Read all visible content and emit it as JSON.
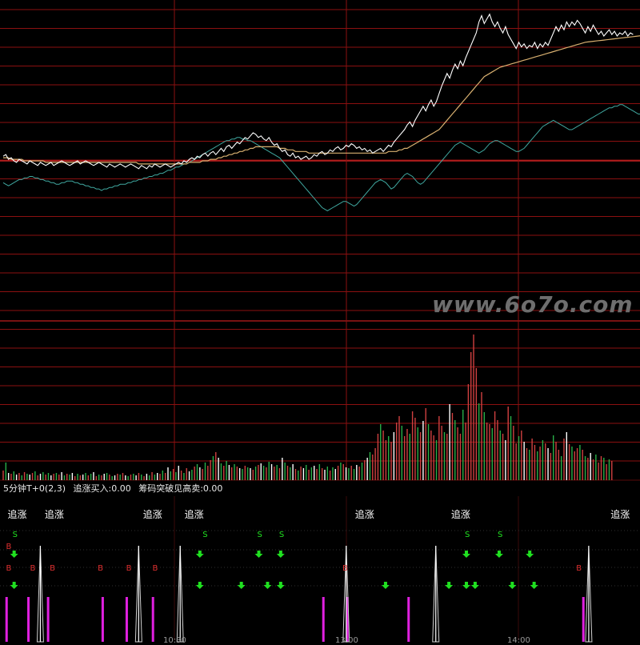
{
  "watermark": "www.6o7o.com",
  "indicator": {
    "name": "5分钟T+0(2,3)",
    "buy_label": "追涨买入:0.00",
    "sell_label": "筹码突破见高卖:0.00"
  },
  "chase_label": "追涨",
  "buy_marker": "B",
  "sell_marker": "S",
  "colors": {
    "background": "#000000",
    "grid": "#8b1010",
    "price": "#ffffff",
    "avg_price": "#d8b070",
    "ma_line": "#40a8a0",
    "vol_up": "#d04040",
    "vol_down": "#28b048",
    "vol_flat": "#ffffff",
    "bar_magenta": "#e020e0",
    "arrow": "#20e020",
    "b_marker": "#e03030",
    "s_marker": "#20e020"
  },
  "chart_data": {
    "type": "line",
    "panels": [
      "price",
      "volume",
      "indicator"
    ],
    "x_count": 240,
    "price": [
      0.3,
      0.4,
      0.1,
      0.2,
      0.0,
      -0.1,
      0.1,
      0.0,
      -0.1,
      -0.2,
      0.0,
      -0.1,
      -0.2,
      -0.3,
      -0.1,
      -0.2,
      -0.3,
      -0.2,
      -0.1,
      -0.3,
      -0.2,
      -0.1,
      0.0,
      -0.1,
      -0.2,
      -0.3,
      -0.2,
      -0.1,
      0.0,
      -0.2,
      -0.1,
      0.0,
      -0.1,
      -0.2,
      -0.3,
      -0.2,
      -0.1,
      -0.2,
      -0.3,
      -0.4,
      -0.2,
      -0.3,
      -0.4,
      -0.3,
      -0.2,
      -0.3,
      -0.4,
      -0.3,
      -0.2,
      -0.3,
      -0.4,
      -0.5,
      -0.3,
      -0.4,
      -0.5,
      -0.3,
      -0.4,
      -0.2,
      -0.3,
      -0.4,
      -0.3,
      -0.2,
      -0.3,
      -0.4,
      -0.3,
      -0.2,
      -0.1,
      -0.2,
      0.0,
      -0.1,
      0.1,
      0.2,
      0.1,
      0.3,
      0.2,
      0.4,
      0.5,
      0.3,
      0.5,
      0.6,
      0.4,
      0.6,
      0.8,
      0.6,
      0.9,
      1.0,
      0.8,
      1.0,
      1.2,
      1.1,
      1.3,
      1.5,
      1.4,
      1.6,
      1.8,
      1.7,
      1.5,
      1.6,
      1.4,
      1.3,
      1.5,
      1.2,
      1.0,
      1.1,
      0.8,
      0.6,
      0.7,
      0.4,
      0.3,
      0.5,
      0.2,
      0.3,
      0.1,
      0.2,
      0.3,
      0.1,
      0.2,
      0.4,
      0.3,
      0.5,
      0.6,
      0.4,
      0.5,
      0.7,
      0.6,
      0.8,
      0.9,
      0.7,
      0.8,
      1.0,
      0.9,
      1.1,
      1.0,
      0.8,
      0.9,
      0.7,
      0.8,
      0.6,
      0.7,
      0.5,
      0.6,
      0.7,
      0.8,
      0.6,
      0.8,
      1.0,
      0.9,
      1.2,
      1.4,
      1.6,
      1.8,
      2.0,
      2.3,
      2.5,
      2.2,
      2.6,
      2.9,
      3.2,
      3.5,
      3.2,
      3.6,
      3.9,
      3.5,
      3.8,
      4.3,
      4.8,
      5.2,
      5.6,
      5.3,
      5.8,
      6.2,
      5.9,
      6.4,
      6.1,
      6.6,
      7.0,
      7.4,
      7.8,
      8.2,
      8.9,
      9.3,
      8.8,
      9.1,
      9.4,
      8.9,
      8.6,
      8.9,
      8.5,
      8.2,
      8.6,
      8.1,
      7.8,
      7.5,
      7.2,
      7.6,
      7.3,
      7.5,
      7.2,
      7.4,
      7.3,
      7.6,
      7.2,
      7.5,
      7.3,
      7.6,
      7.4,
      7.8,
      8.2,
      8.6,
      8.3,
      8.7,
      8.4,
      8.9,
      8.6,
      8.9,
      8.7,
      9.0,
      8.8,
      8.5,
      8.2,
      8.6,
      8.3,
      8.7,
      8.4,
      8.1,
      8.3,
      8.0,
      8.2,
      8.4,
      8.1,
      8.3,
      8.0,
      8.2,
      8.1,
      8.3,
      8.0,
      8.2,
      8.1
    ],
    "avg_price": [
      0.2,
      0.2,
      0.2,
      0.1,
      0.1,
      0.1,
      0.1,
      0.1,
      0.0,
      0.0,
      0.0,
      0.0,
      0.0,
      0.0,
      0.0,
      0.0,
      -0.1,
      -0.1,
      -0.1,
      -0.1,
      -0.1,
      -0.1,
      -0.1,
      -0.1,
      -0.1,
      -0.1,
      -0.1,
      -0.1,
      -0.1,
      -0.1,
      -0.1,
      -0.1,
      -0.1,
      -0.1,
      -0.1,
      -0.1,
      -0.1,
      -0.1,
      -0.1,
      -0.1,
      -0.1,
      -0.1,
      -0.1,
      -0.1,
      -0.1,
      -0.1,
      -0.1,
      -0.1,
      -0.1,
      -0.1,
      -0.1,
      -0.2,
      -0.2,
      -0.2,
      -0.2,
      -0.2,
      -0.2,
      -0.2,
      -0.2,
      -0.2,
      -0.2,
      -0.2,
      -0.2,
      -0.2,
      -0.2,
      -0.2,
      -0.2,
      -0.2,
      -0.2,
      -0.2,
      -0.1,
      -0.1,
      -0.1,
      -0.1,
      -0.1,
      0.0,
      0.0,
      0.0,
      0.1,
      0.1,
      0.1,
      0.2,
      0.2,
      0.3,
      0.3,
      0.4,
      0.4,
      0.5,
      0.5,
      0.6,
      0.6,
      0.7,
      0.7,
      0.8,
      0.8,
      0.9,
      0.9,
      0.9,
      0.9,
      0.9,
      0.9,
      0.9,
      0.9,
      0.9,
      0.8,
      0.8,
      0.8,
      0.7,
      0.7,
      0.7,
      0.6,
      0.6,
      0.6,
      0.6,
      0.6,
      0.5,
      0.5,
      0.5,
      0.5,
      0.5,
      0.5,
      0.5,
      0.5,
      0.5,
      0.5,
      0.5,
      0.5,
      0.5,
      0.5,
      0.5,
      0.5,
      0.5,
      0.5,
      0.5,
      0.5,
      0.5,
      0.5,
      0.5,
      0.5,
      0.5,
      0.5,
      0.5,
      0.5,
      0.5,
      0.5,
      0.6,
      0.6,
      0.6,
      0.6,
      0.7,
      0.7,
      0.8,
      0.8,
      0.9,
      1.0,
      1.1,
      1.2,
      1.3,
      1.4,
      1.5,
      1.6,
      1.7,
      1.8,
      1.9,
      2.0,
      2.2,
      2.4,
      2.6,
      2.8,
      3.0,
      3.2,
      3.4,
      3.6,
      3.8,
      4.0,
      4.2,
      4.4,
      4.6,
      4.8,
      5.0,
      5.2,
      5.4,
      5.5,
      5.6,
      5.7,
      5.8,
      5.9,
      6.0,
      6.05,
      6.1,
      6.15,
      6.2,
      6.25,
      6.3,
      6.35,
      6.4,
      6.45,
      6.5,
      6.55,
      6.6,
      6.65,
      6.7,
      6.75,
      6.8,
      6.85,
      6.9,
      6.95,
      7.0,
      7.05,
      7.1,
      7.15,
      7.2,
      7.25,
      7.3,
      7.35,
      7.4,
      7.45,
      7.5,
      7.55,
      7.6,
      7.62,
      7.64,
      7.66,
      7.68,
      7.7,
      7.72,
      7.74,
      7.76,
      7.78,
      7.8,
      7.82,
      7.84,
      7.86,
      7.88,
      7.9,
      7.92,
      7.94,
      7.96,
      7.98,
      8.0,
      8.02,
      8.04,
      8.05,
      8.06,
      8.07,
      8.08,
      8.09,
      8.1,
      8.1,
      8.1,
      8.1,
      8.1
    ],
    "ma_line": [
      -1.4,
      -1.5,
      -1.6,
      -1.5,
      -1.4,
      -1.3,
      -1.2,
      -1.2,
      -1.1,
      -1.1,
      -1.0,
      -1.0,
      -1.1,
      -1.1,
      -1.2,
      -1.2,
      -1.3,
      -1.3,
      -1.4,
      -1.4,
      -1.5,
      -1.5,
      -1.4,
      -1.4,
      -1.3,
      -1.3,
      -1.3,
      -1.4,
      -1.4,
      -1.5,
      -1.5,
      -1.6,
      -1.6,
      -1.7,
      -1.7,
      -1.8,
      -1.8,
      -1.9,
      -1.8,
      -1.8,
      -1.7,
      -1.7,
      -1.6,
      -1.6,
      -1.5,
      -1.5,
      -1.5,
      -1.4,
      -1.4,
      -1.3,
      -1.3,
      -1.2,
      -1.2,
      -1.1,
      -1.1,
      -1.0,
      -1.0,
      -0.9,
      -0.9,
      -0.8,
      -0.8,
      -0.7,
      -0.6,
      -0.6,
      -0.5,
      -0.4,
      -0.4,
      -0.3,
      -0.2,
      -0.2,
      -0.1,
      0.0,
      0.1,
      0.2,
      0.3,
      0.4,
      0.5,
      0.6,
      0.7,
      0.8,
      0.9,
      1.0,
      1.1,
      1.2,
      1.3,
      1.3,
      1.4,
      1.4,
      1.5,
      1.5,
      1.4,
      1.4,
      1.3,
      1.3,
      1.2,
      1.1,
      1.0,
      0.9,
      0.8,
      0.7,
      0.6,
      0.5,
      0.4,
      0.3,
      0.2,
      0.0,
      -0.2,
      -0.4,
      -0.6,
      -0.8,
      -1.0,
      -1.2,
      -1.4,
      -1.6,
      -1.8,
      -2.0,
      -2.2,
      -2.4,
      -2.6,
      -2.8,
      -3.0,
      -3.1,
      -3.2,
      -3.1,
      -3.0,
      -2.9,
      -2.8,
      -2.7,
      -2.6,
      -2.6,
      -2.7,
      -2.8,
      -2.9,
      -2.8,
      -2.6,
      -2.4,
      -2.2,
      -2.0,
      -1.8,
      -1.6,
      -1.4,
      -1.3,
      -1.2,
      -1.3,
      -1.4,
      -1.6,
      -1.8,
      -1.7,
      -1.5,
      -1.3,
      -1.1,
      -0.9,
      -0.8,
      -0.9,
      -1.0,
      -1.2,
      -1.4,
      -1.5,
      -1.4,
      -1.2,
      -1.0,
      -0.8,
      -0.6,
      -0.4,
      -0.2,
      0.0,
      0.2,
      0.4,
      0.6,
      0.8,
      1.0,
      1.1,
      1.2,
      1.1,
      1.0,
      0.9,
      0.8,
      0.7,
      0.6,
      0.5,
      0.6,
      0.7,
      0.9,
      1.1,
      1.2,
      1.3,
      1.3,
      1.2,
      1.1,
      1.0,
      0.9,
      0.8,
      0.7,
      0.6,
      0.6,
      0.7,
      0.8,
      1.0,
      1.2,
      1.4,
      1.6,
      1.8,
      2.0,
      2.2,
      2.3,
      2.4,
      2.5,
      2.6,
      2.5,
      2.4,
      2.3,
      2.2,
      2.1,
      2.0,
      2.0,
      2.1,
      2.2,
      2.3,
      2.4,
      2.5,
      2.6,
      2.7,
      2.8,
      2.9,
      3.0,
      3.1,
      3.2,
      3.3,
      3.4,
      3.4,
      3.5,
      3.5,
      3.6,
      3.6,
      3.5,
      3.4,
      3.3,
      3.2,
      3.1,
      3.0,
      3.0,
      3.1,
      3.2,
      3.3,
      3.4
    ],
    "volume": [
      12,
      22,
      9,
      8,
      11,
      7,
      9,
      6,
      10,
      8,
      7,
      9,
      11,
      6,
      8,
      10,
      7,
      9,
      6,
      8,
      9,
      7,
      10,
      6,
      8,
      7,
      9,
      5,
      8,
      6,
      7,
      9,
      6,
      8,
      10,
      5,
      7,
      6,
      8,
      9,
      7,
      5,
      6,
      8,
      7,
      9,
      6,
      5,
      7,
      8,
      6,
      9,
      7,
      5,
      8,
      6,
      10,
      7,
      9,
      8,
      12,
      9,
      16,
      11,
      14,
      10,
      18,
      12,
      9,
      15,
      11,
      13,
      17,
      20,
      16,
      14,
      22,
      18,
      25,
      30,
      35,
      28,
      21,
      18,
      24,
      19,
      16,
      20,
      17,
      15,
      14,
      18,
      16,
      15,
      13,
      17,
      19,
      21,
      18,
      16,
      23,
      20,
      17,
      19,
      15,
      28,
      22,
      18,
      16,
      20,
      14,
      12,
      17,
      15,
      19,
      13,
      16,
      18,
      14,
      20,
      15,
      13,
      17,
      12,
      16,
      14,
      18,
      22,
      20,
      16,
      15,
      18,
      14,
      19,
      17,
      22,
      25,
      28,
      35,
      32,
      40,
      58,
      70,
      62,
      50,
      55,
      48,
      60,
      72,
      80,
      68,
      55,
      64,
      58,
      86,
      78,
      66,
      60,
      74,
      90,
      70,
      62,
      56,
      50,
      80,
      68,
      60,
      58,
      95,
      84,
      75,
      66,
      58,
      88,
      72,
      120,
      160,
      182,
      140,
      96,
      110,
      85,
      72,
      70,
      65,
      86,
      75,
      62,
      58,
      50,
      92,
      80,
      68,
      46,
      55,
      62,
      48,
      40,
      38,
      52,
      44,
      36,
      42,
      50,
      46,
      40,
      34,
      56,
      48,
      38,
      30,
      52,
      60,
      45,
      42,
      36,
      40,
      44,
      38,
      30,
      28,
      34,
      26,
      32,
      22,
      30,
      28,
      20,
      26,
      24
    ],
    "volume_color": [
      "u",
      "d",
      "f",
      "u",
      "d",
      "f",
      "u",
      "d",
      "u",
      "d",
      "f",
      "u",
      "d",
      "u",
      "f",
      "d",
      "u",
      "d",
      "f",
      "u",
      "d",
      "u",
      "f",
      "d",
      "u",
      "d",
      "f",
      "u",
      "d",
      "u",
      "f",
      "d",
      "u",
      "d",
      "f",
      "u",
      "d",
      "u",
      "f",
      "d",
      "u",
      "d",
      "f",
      "u",
      "d",
      "u",
      "f",
      "d",
      "u",
      "d",
      "f",
      "u",
      "d",
      "u",
      "f",
      "d",
      "u",
      "d",
      "f",
      "u",
      "d",
      "u",
      "f",
      "d",
      "u",
      "d",
      "f",
      "u",
      "d",
      "u",
      "f",
      "d",
      "u",
      "d",
      "f",
      "u",
      "d",
      "u",
      "u",
      "d",
      "u",
      "f",
      "d",
      "u",
      "d",
      "f",
      "u",
      "d",
      "u",
      "f",
      "d",
      "u",
      "d",
      "f",
      "u",
      "d",
      "u",
      "f",
      "d",
      "u",
      "d",
      "f",
      "u",
      "d",
      "u",
      "f",
      "d",
      "u",
      "d",
      "f",
      "u",
      "d",
      "u",
      "f",
      "d",
      "u",
      "d",
      "f",
      "u",
      "d",
      "u",
      "f",
      "d",
      "u",
      "d",
      "f",
      "u",
      "d",
      "u",
      "f",
      "d",
      "u",
      "d",
      "f",
      "u",
      "d",
      "u",
      "f",
      "d",
      "u",
      "u",
      "u",
      "d",
      "u",
      "u",
      "d",
      "u",
      "f",
      "u",
      "u",
      "d",
      "u",
      "u",
      "d",
      "u",
      "u",
      "d",
      "u",
      "f",
      "u",
      "d",
      "u",
      "u",
      "d",
      "u",
      "u",
      "d",
      "u",
      "f",
      "u",
      "d",
      "u",
      "u",
      "d",
      "u",
      "u",
      "u",
      "u",
      "u",
      "d",
      "u",
      "d",
      "u",
      "u",
      "d",
      "u",
      "u",
      "d",
      "u",
      "f",
      "u",
      "d",
      "u",
      "u",
      "d",
      "u",
      "f",
      "u",
      "d",
      "u",
      "u",
      "d",
      "u",
      "d",
      "u",
      "f",
      "u",
      "d",
      "u",
      "u",
      "d",
      "u",
      "f",
      "u",
      "d",
      "u",
      "u",
      "d",
      "u",
      "d",
      "u",
      "f",
      "u",
      "d",
      "u",
      "u",
      "d",
      "u",
      "d",
      "u",
      "f",
      "u",
      "d"
    ],
    "chase_positions": [
      2,
      19,
      64,
      83,
      161,
      205,
      278
    ],
    "s_markers": [
      [
        5,
        "row1"
      ],
      [
        92,
        "row1"
      ],
      [
        117,
        "row1"
      ],
      [
        127,
        "row1"
      ],
      [
        212,
        "row1"
      ],
      [
        227,
        "row1"
      ]
    ],
    "b_markers": [
      [
        2,
        "row1"
      ],
      [
        2,
        "row2"
      ],
      [
        13,
        "row2"
      ],
      [
        22,
        "row2"
      ],
      [
        44,
        "row2"
      ],
      [
        57,
        "row2"
      ],
      [
        69,
        "row2"
      ],
      [
        156,
        "row2"
      ],
      [
        263,
        "row2"
      ]
    ],
    "arrows_row1": [
      5,
      90,
      117,
      127,
      212,
      227,
      241
    ],
    "arrows_row2": [
      5,
      90,
      109,
      121,
      127,
      175,
      204,
      212,
      216,
      233,
      243
    ],
    "magenta_bars": [
      1,
      11,
      20,
      45,
      56,
      68,
      146,
      157,
      185,
      265
    ],
    "spikes": [
      17,
      62,
      81,
      157,
      198,
      268
    ]
  },
  "time_labels": [
    "10:30",
    "13:00",
    "14:00"
  ]
}
